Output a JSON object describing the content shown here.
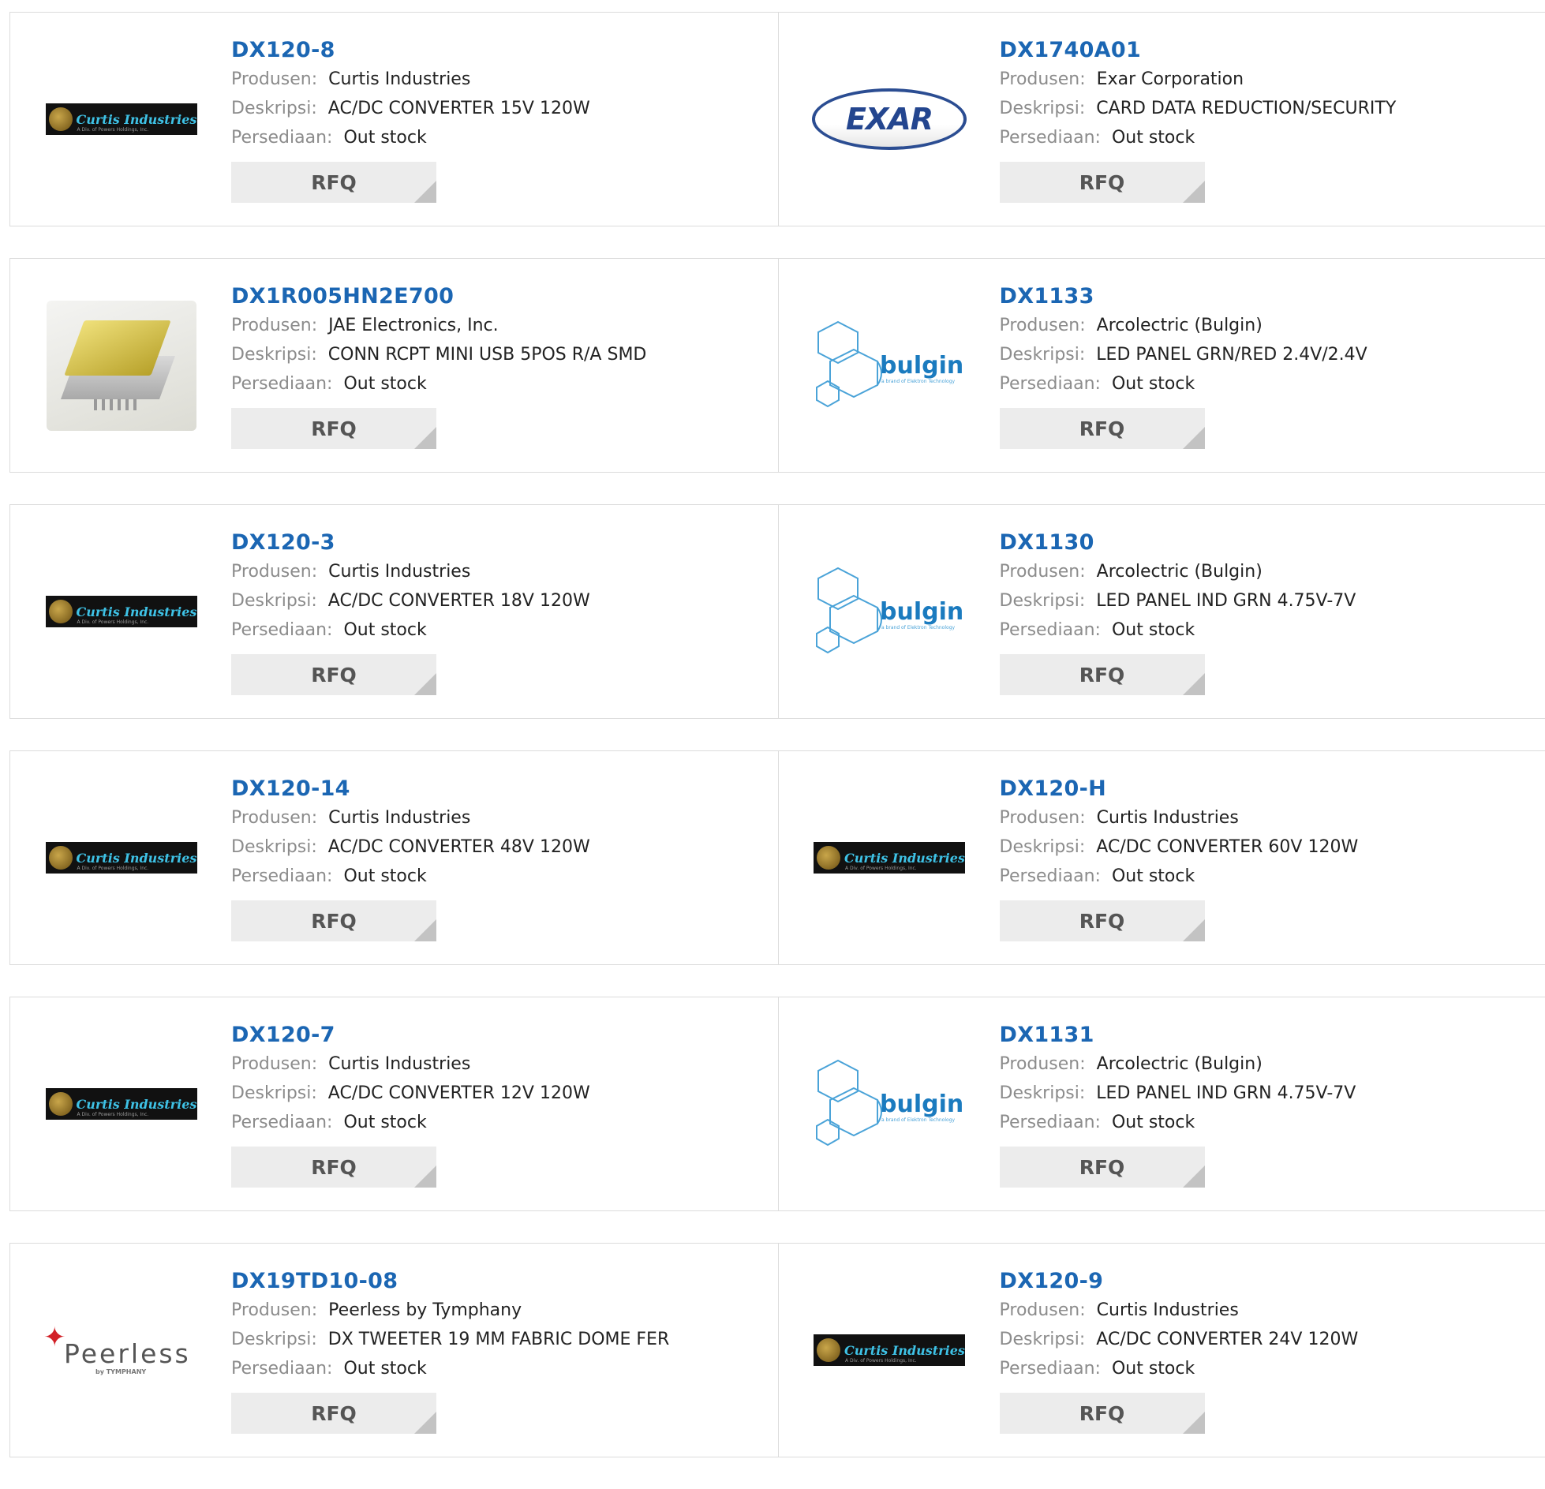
{
  "labels": {
    "manufacturer": "Produsen:",
    "description": "Deskripsi:",
    "stock": "Persediaan:",
    "rfq": "RFQ"
  },
  "rows": [
    [
      {
        "part": "DX120-8",
        "manufacturer": "Curtis Industries",
        "description": "AC/DC CONVERTER 15V 120W",
        "stock": "Out stock",
        "logo": "curtis"
      },
      {
        "part": "DX1740A01",
        "manufacturer": "Exar Corporation",
        "description": "CARD DATA REDUCTION/SECURITY",
        "stock": "Out stock",
        "logo": "exar"
      }
    ],
    [
      {
        "part": "DX1R005HN2E700",
        "manufacturer": "JAE Electronics, Inc.",
        "description": "CONN RCPT MINI USB 5POS R/A SMD",
        "stock": "Out stock",
        "logo": "usb"
      },
      {
        "part": "DX1133",
        "manufacturer": "Arcolectric (Bulgin)",
        "description": "LED PANEL GRN/RED 2.4V/2.4V",
        "stock": "Out stock",
        "logo": "bulgin"
      }
    ],
    [
      {
        "part": "DX120-3",
        "manufacturer": "Curtis Industries",
        "description": "AC/DC CONVERTER 18V 120W",
        "stock": "Out stock",
        "logo": "curtis"
      },
      {
        "part": "DX1130",
        "manufacturer": "Arcolectric (Bulgin)",
        "description": "LED PANEL IND GRN 4.75V-7V",
        "stock": "Out stock",
        "logo": "bulgin"
      }
    ],
    [
      {
        "part": "DX120-14",
        "manufacturer": "Curtis Industries",
        "description": "AC/DC CONVERTER 48V 120W",
        "stock": "Out stock",
        "logo": "curtis"
      },
      {
        "part": "DX120-H",
        "manufacturer": "Curtis Industries",
        "description": "AC/DC CONVERTER 60V 120W",
        "stock": "Out stock",
        "logo": "curtis"
      }
    ],
    [
      {
        "part": "DX120-7",
        "manufacturer": "Curtis Industries",
        "description": "AC/DC CONVERTER 12V 120W",
        "stock": "Out stock",
        "logo": "curtis"
      },
      {
        "part": "DX1131",
        "manufacturer": "Arcolectric (Bulgin)",
        "description": "LED PANEL IND GRN 4.75V-7V",
        "stock": "Out stock",
        "logo": "bulgin"
      }
    ],
    [
      {
        "part": "DX19TD10-08",
        "manufacturer": "Peerless by Tymphany",
        "description": "DX TWEETER 19 MM FABRIC DOME FER",
        "stock": "Out stock",
        "logo": "peerless"
      },
      {
        "part": "DX120-9",
        "manufacturer": "Curtis Industries",
        "description": "AC/DC CONVERTER 24V 120W",
        "stock": "Out stock",
        "logo": "curtis"
      }
    ]
  ],
  "logos": {
    "curtis": {
      "text": "Curtis Industries",
      "subtext": "A Div. of Powers Holdings, Inc."
    },
    "exar": {
      "text": "EXAR"
    },
    "bulgin": {
      "text": "bulgin",
      "subtext": "a brand of Elektron Technology"
    },
    "peerless": {
      "text": "Peerless",
      "subtext": "by TYMPHANY"
    }
  },
  "colors": {
    "link": "#1b66b3",
    "label": "#8c8c8c",
    "border": "#dcdcdc",
    "button_bg": "#ececec"
  }
}
